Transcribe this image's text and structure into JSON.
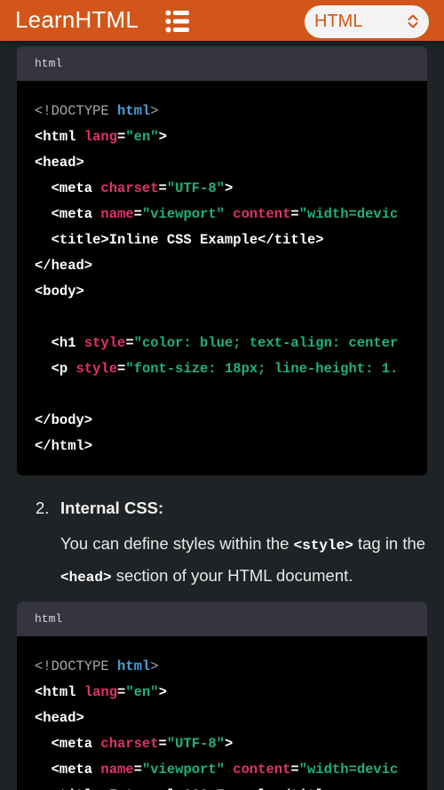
{
  "header": {
    "brand": "LearnHTML",
    "menu_icon": "list-menu-icon",
    "language_select": {
      "value": "HTML"
    }
  },
  "colors": {
    "header_bg": "#d2561a",
    "page_bg": "#202325",
    "code_bg": "#000000",
    "code_header_bg": "#34353f",
    "keyword": "#4a9fd8",
    "attribute": "#e0316b",
    "string": "#1fb27a"
  },
  "code_block_1": {
    "lang": "html",
    "lines": [
      [
        {
          "t": "<!DOCTYPE ",
          "c": "doc"
        },
        {
          "t": "html",
          "c": "kw"
        },
        {
          "t": ">",
          "c": "doc"
        }
      ],
      [
        {
          "t": "<html ",
          "c": "txt"
        },
        {
          "t": "lang",
          "c": "attr"
        },
        {
          "t": "=",
          "c": "txt"
        },
        {
          "t": "\"en\"",
          "c": "str"
        },
        {
          "t": ">",
          "c": "txt"
        }
      ],
      [
        {
          "t": "<head>",
          "c": "txt"
        }
      ],
      [
        {
          "t": "  <meta ",
          "c": "txt"
        },
        {
          "t": "charset",
          "c": "attr"
        },
        {
          "t": "=",
          "c": "txt"
        },
        {
          "t": "\"UTF-8\"",
          "c": "str"
        },
        {
          "t": ">",
          "c": "txt"
        }
      ],
      [
        {
          "t": "  <meta ",
          "c": "txt"
        },
        {
          "t": "name",
          "c": "attr"
        },
        {
          "t": "=",
          "c": "txt"
        },
        {
          "t": "\"viewport\" ",
          "c": "str"
        },
        {
          "t": "content",
          "c": "attr"
        },
        {
          "t": "=",
          "c": "txt"
        },
        {
          "t": "\"width=devic",
          "c": "str"
        }
      ],
      [
        {
          "t": "  <title>Inline CSS Example</title>",
          "c": "txt"
        }
      ],
      [
        {
          "t": "</head>",
          "c": "txt"
        }
      ],
      [
        {
          "t": "<body>",
          "c": "txt"
        }
      ],
      [
        {
          "t": "",
          "c": "txt"
        }
      ],
      [
        {
          "t": "  <h1 ",
          "c": "txt"
        },
        {
          "t": "style",
          "c": "attr"
        },
        {
          "t": "=",
          "c": "txt"
        },
        {
          "t": "\"color: blue; text-align: center",
          "c": "str"
        }
      ],
      [
        {
          "t": "  <p ",
          "c": "txt"
        },
        {
          "t": "style",
          "c": "attr"
        },
        {
          "t": "=",
          "c": "txt"
        },
        {
          "t": "\"font-size: 18px; line-height: 1.",
          "c": "str"
        }
      ],
      [
        {
          "t": "",
          "c": "txt"
        }
      ],
      [
        {
          "t": "</body>",
          "c": "txt"
        }
      ],
      [
        {
          "t": "</html>",
          "c": "txt"
        }
      ]
    ]
  },
  "list_item": {
    "number": "2.",
    "title": "Internal CSS:",
    "desc_parts": [
      {
        "t": "You can define styles within the ",
        "c": "text"
      },
      {
        "t": "<style>",
        "c": "code"
      },
      {
        "t": " tag in the ",
        "c": "text"
      },
      {
        "t": "<head>",
        "c": "code"
      },
      {
        "t": " section of your HTML document.",
        "c": "text"
      }
    ]
  },
  "code_block_2": {
    "lang": "html",
    "lines": [
      [
        {
          "t": "<!DOCTYPE ",
          "c": "doc"
        },
        {
          "t": "html",
          "c": "kw"
        },
        {
          "t": ">",
          "c": "doc"
        }
      ],
      [
        {
          "t": "<html ",
          "c": "txt"
        },
        {
          "t": "lang",
          "c": "attr"
        },
        {
          "t": "=",
          "c": "txt"
        },
        {
          "t": "\"en\"",
          "c": "str"
        },
        {
          "t": ">",
          "c": "txt"
        }
      ],
      [
        {
          "t": "<head>",
          "c": "txt"
        }
      ],
      [
        {
          "t": "  <meta ",
          "c": "txt"
        },
        {
          "t": "charset",
          "c": "attr"
        },
        {
          "t": "=",
          "c": "txt"
        },
        {
          "t": "\"UTF-8\"",
          "c": "str"
        },
        {
          "t": ">",
          "c": "txt"
        }
      ],
      [
        {
          "t": "  <meta ",
          "c": "txt"
        },
        {
          "t": "name",
          "c": "attr"
        },
        {
          "t": "=",
          "c": "txt"
        },
        {
          "t": "\"viewport\" ",
          "c": "str"
        },
        {
          "t": "content",
          "c": "attr"
        },
        {
          "t": "=",
          "c": "txt"
        },
        {
          "t": "\"width=devic",
          "c": "str"
        }
      ],
      [
        {
          "t": "  <title>Internal CSS Example</title>",
          "c": "txt"
        }
      ]
    ]
  }
}
